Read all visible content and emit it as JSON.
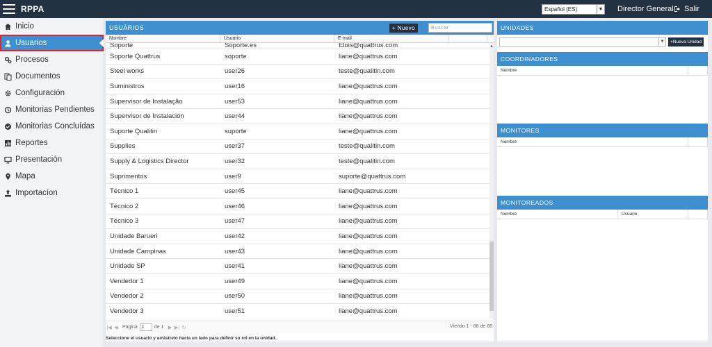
{
  "app": {
    "title": "RPPA"
  },
  "header": {
    "language": "Español (ES)",
    "role": "Director General",
    "logout_label": "Salir"
  },
  "sidebar": {
    "items": [
      {
        "label": "Inicio",
        "icon": "home-icon"
      },
      {
        "label": "Usuarios",
        "icon": "user-icon",
        "active": true
      },
      {
        "label": "Procesos",
        "icon": "cogs-icon"
      },
      {
        "label": "Documentos",
        "icon": "documents-icon"
      },
      {
        "label": "Configuración",
        "icon": "gear-icon"
      },
      {
        "label": "Monitorias Pendientes",
        "icon": "history-icon"
      },
      {
        "label": "Monitorias Concluídas",
        "icon": "check-circle-icon"
      },
      {
        "label": "Reportes",
        "icon": "chart-icon"
      },
      {
        "label": "Presentación",
        "icon": "presentation-icon"
      },
      {
        "label": "Mapa",
        "icon": "map-marker-icon"
      },
      {
        "label": "Importacíon",
        "icon": "upload-icon"
      }
    ]
  },
  "users": {
    "title": "USUÁRIOS",
    "new_button": "+ Nuevo",
    "search_placeholder": "Buscar",
    "columns": [
      "Nombre",
      "Usuario",
      "E-mail"
    ],
    "rows": [
      [
        "Soporte",
        "Soporte.es",
        "Elois@quattrus.com"
      ],
      [
        "Soporte Quattrus",
        "soporte",
        "liane@quattrus.com"
      ],
      [
        "Steel works",
        "user26",
        "teste@qualitin.com"
      ],
      [
        "Suministros",
        "user16",
        "liane@quattrus.com"
      ],
      [
        "Supervisor de Instalação",
        "user53",
        "liane@quattrus.com"
      ],
      [
        "Supervisor de Instalación",
        "user44",
        "liane@quattrus.com"
      ],
      [
        "Suporte Qualitin",
        "suporte",
        "liane@quattrus.com"
      ],
      [
        "Supplies",
        "user37",
        "teste@qualitin.com"
      ],
      [
        "Supply & Logistics Director",
        "user32",
        "teste@qualitin.com"
      ],
      [
        "Suprimentos",
        "user9",
        "suporte@quattrus.com"
      ],
      [
        "Técnico 1",
        "user45",
        "liane@quattrus.com"
      ],
      [
        "Técnico 2",
        "user46",
        "liane@quattrus.com"
      ],
      [
        "Técnico 3",
        "user47",
        "liane@quattrus.com"
      ],
      [
        "Unidade Barueri",
        "user42",
        "liane@quattrus.com"
      ],
      [
        "Unidade Campinas",
        "user43",
        "liane@quattrus.com"
      ],
      [
        "Unidade SP",
        "user41",
        "liane@quattrus.com"
      ],
      [
        "Vendedor 1",
        "user49",
        "liane@quattrus.com"
      ],
      [
        "Vendedor 2",
        "user50",
        "liane@quattrus.com"
      ],
      [
        "Vendedor 3",
        "user51",
        "liane@quattrus.com"
      ]
    ],
    "pager": {
      "page_label": "Página",
      "page_value": "1",
      "of_label": "de 1",
      "view_info": "Viendo 1 - 66 de 66"
    },
    "instructions": "Seleccione el usuario y arrástrelo hacia un lado para definir su rol en la unidad.."
  },
  "units": {
    "title": "UNIDADES",
    "new_unit_button": "+Nueva Unidad"
  },
  "coordinators": {
    "title": "COORDINADORES",
    "columns": [
      "Nombre"
    ]
  },
  "monitors": {
    "title": "MONITORES",
    "columns": [
      "Nombre"
    ]
  },
  "monitored": {
    "title": "MONITOREADOS",
    "columns": [
      "Nombre",
      "Usuario"
    ]
  },
  "colors": {
    "topbar": "#233243",
    "accent": "#3d8fd0",
    "highlight": "#e0242b"
  }
}
